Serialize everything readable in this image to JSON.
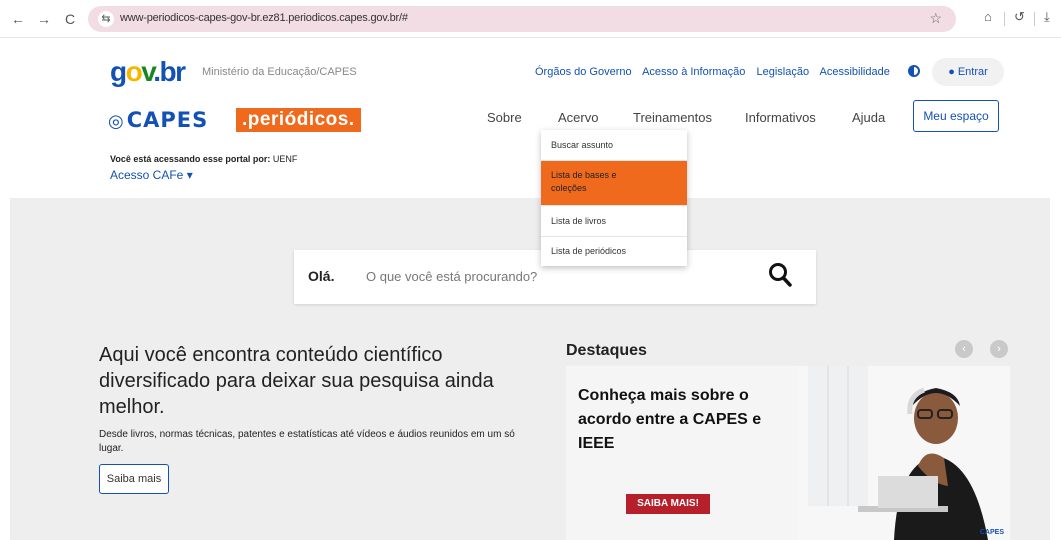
{
  "browser": {
    "url": "www-periodicos-capes-gov-br.ez81.periodicos.capes.gov.br/#",
    "back": "←",
    "forward": "→",
    "reload": "C",
    "site_icon": "⇆",
    "star": "☆",
    "extensions": "⌂",
    "history": "↺",
    "download": "⤓"
  },
  "header": {
    "govbr": {
      "g": "g",
      "o": "o",
      "v": "v",
      "br": ".br"
    },
    "ministry": "Ministério da Educação/CAPES",
    "top_links": [
      "Órgãos do Governo",
      "Acesso à Informação",
      "Legislação",
      "Acessibilidade"
    ],
    "entrar": "Entrar",
    "capes": "CAPES",
    "periodicos": ".periódicos.",
    "nav": [
      "Sobre",
      "Acervo",
      "Treinamentos",
      "Informativos",
      "Ajuda"
    ],
    "meu_espaco": "Meu espaço",
    "access_prefix": "Você está acessando esse portal por:",
    "access_org": "UENF",
    "cafe": "Acesso CAFe ▾"
  },
  "dropdown": {
    "items": [
      "Buscar assunto",
      "Lista de bases e coleções",
      "Lista de livros",
      "Lista de periódicos"
    ],
    "active_index": 1
  },
  "search": {
    "greeting": "Olá.",
    "placeholder": "O que você está procurando?"
  },
  "hero": {
    "title": "Aqui você encontra conteúdo científico diversificado para deixar sua pesquisa ainda melhor.",
    "description": "Desde livros, normas técnicas, patentes e estatísticas até vídeos e áudios reunidos em um só lugar.",
    "button": "Saiba mais"
  },
  "destaques": {
    "title": "Destaques",
    "prev": "‹",
    "next": "›",
    "banner_text": "Conheça mais sobre o acordo entre a CAPES e IEEE",
    "banner_button": "SAIBA MAIS!",
    "banner_mark": "CAPES"
  },
  "colors": {
    "brand_blue": "#1351b4",
    "orange": "#f06a1d",
    "banner_red": "#b5202b"
  }
}
